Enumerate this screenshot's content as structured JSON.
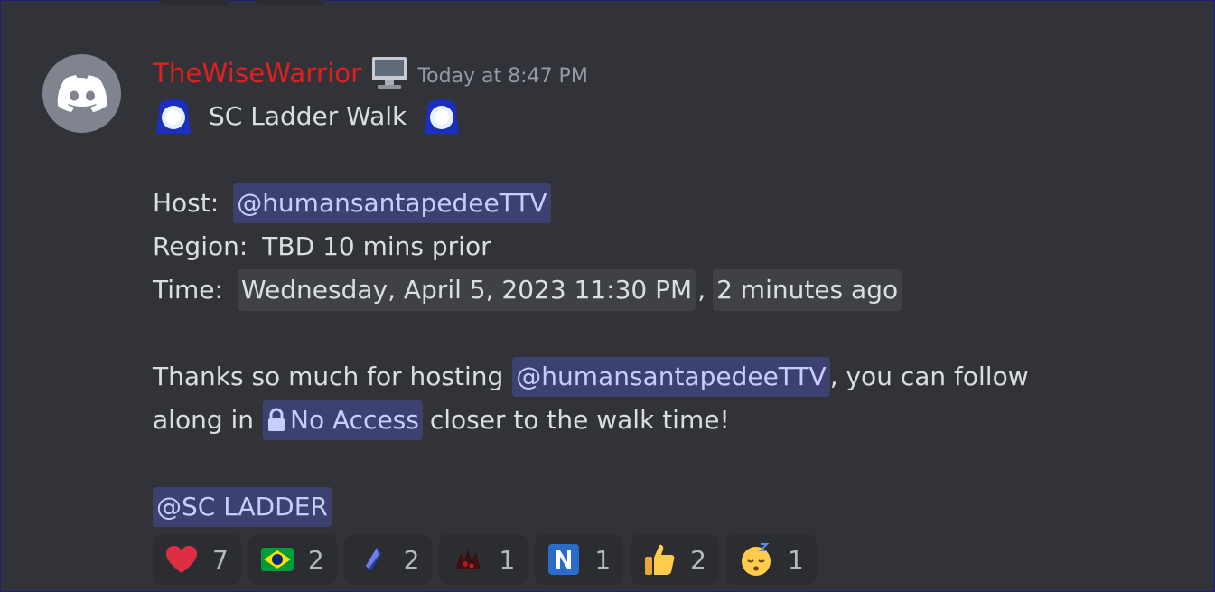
{
  "message": {
    "author": "TheWiseWarrior",
    "timestamp": "Today at 8:47 PM",
    "title": "SC Ladder Walk",
    "host_label": "Host:",
    "host_mention": "@humansantapedeeTTV",
    "region_label": "Region:",
    "region_value": "TBD 10 mins prior",
    "time_label": "Time:",
    "time_value": "Wednesday, April 5, 2023 11:30 PM",
    "time_separator": ",",
    "time_relative": "2 minutes ago",
    "thanks_prefix": "Thanks so much for hosting",
    "thanks_mention": "@humansantapedeeTTV",
    "thanks_suffix": ", you can follow",
    "along_prefix": "along in",
    "channel_name": "No Access",
    "along_suffix": "closer to the walk time!",
    "role_mention": "@SC LADDER"
  },
  "reactions": [
    {
      "emoji": "heart-icon",
      "count": "7"
    },
    {
      "emoji": "brazil-flag-icon",
      "count": "2"
    },
    {
      "emoji": "crystal-icon",
      "count": "2"
    },
    {
      "emoji": "dark-creature-icon",
      "count": "1"
    },
    {
      "emoji": "letter-n-icon",
      "count": "1"
    },
    {
      "emoji": "thumbs-up-icon",
      "count": "2"
    },
    {
      "emoji": "sleeping-face-icon",
      "count": "1"
    }
  ],
  "colors": {
    "background": "#313338",
    "username": "#e0201f",
    "mention_bg": "rgba(88,101,242,0.3)",
    "mention_text": "#c9cdfb",
    "timestamp": "#949ba4",
    "reaction_bg": "#2b2d31"
  }
}
